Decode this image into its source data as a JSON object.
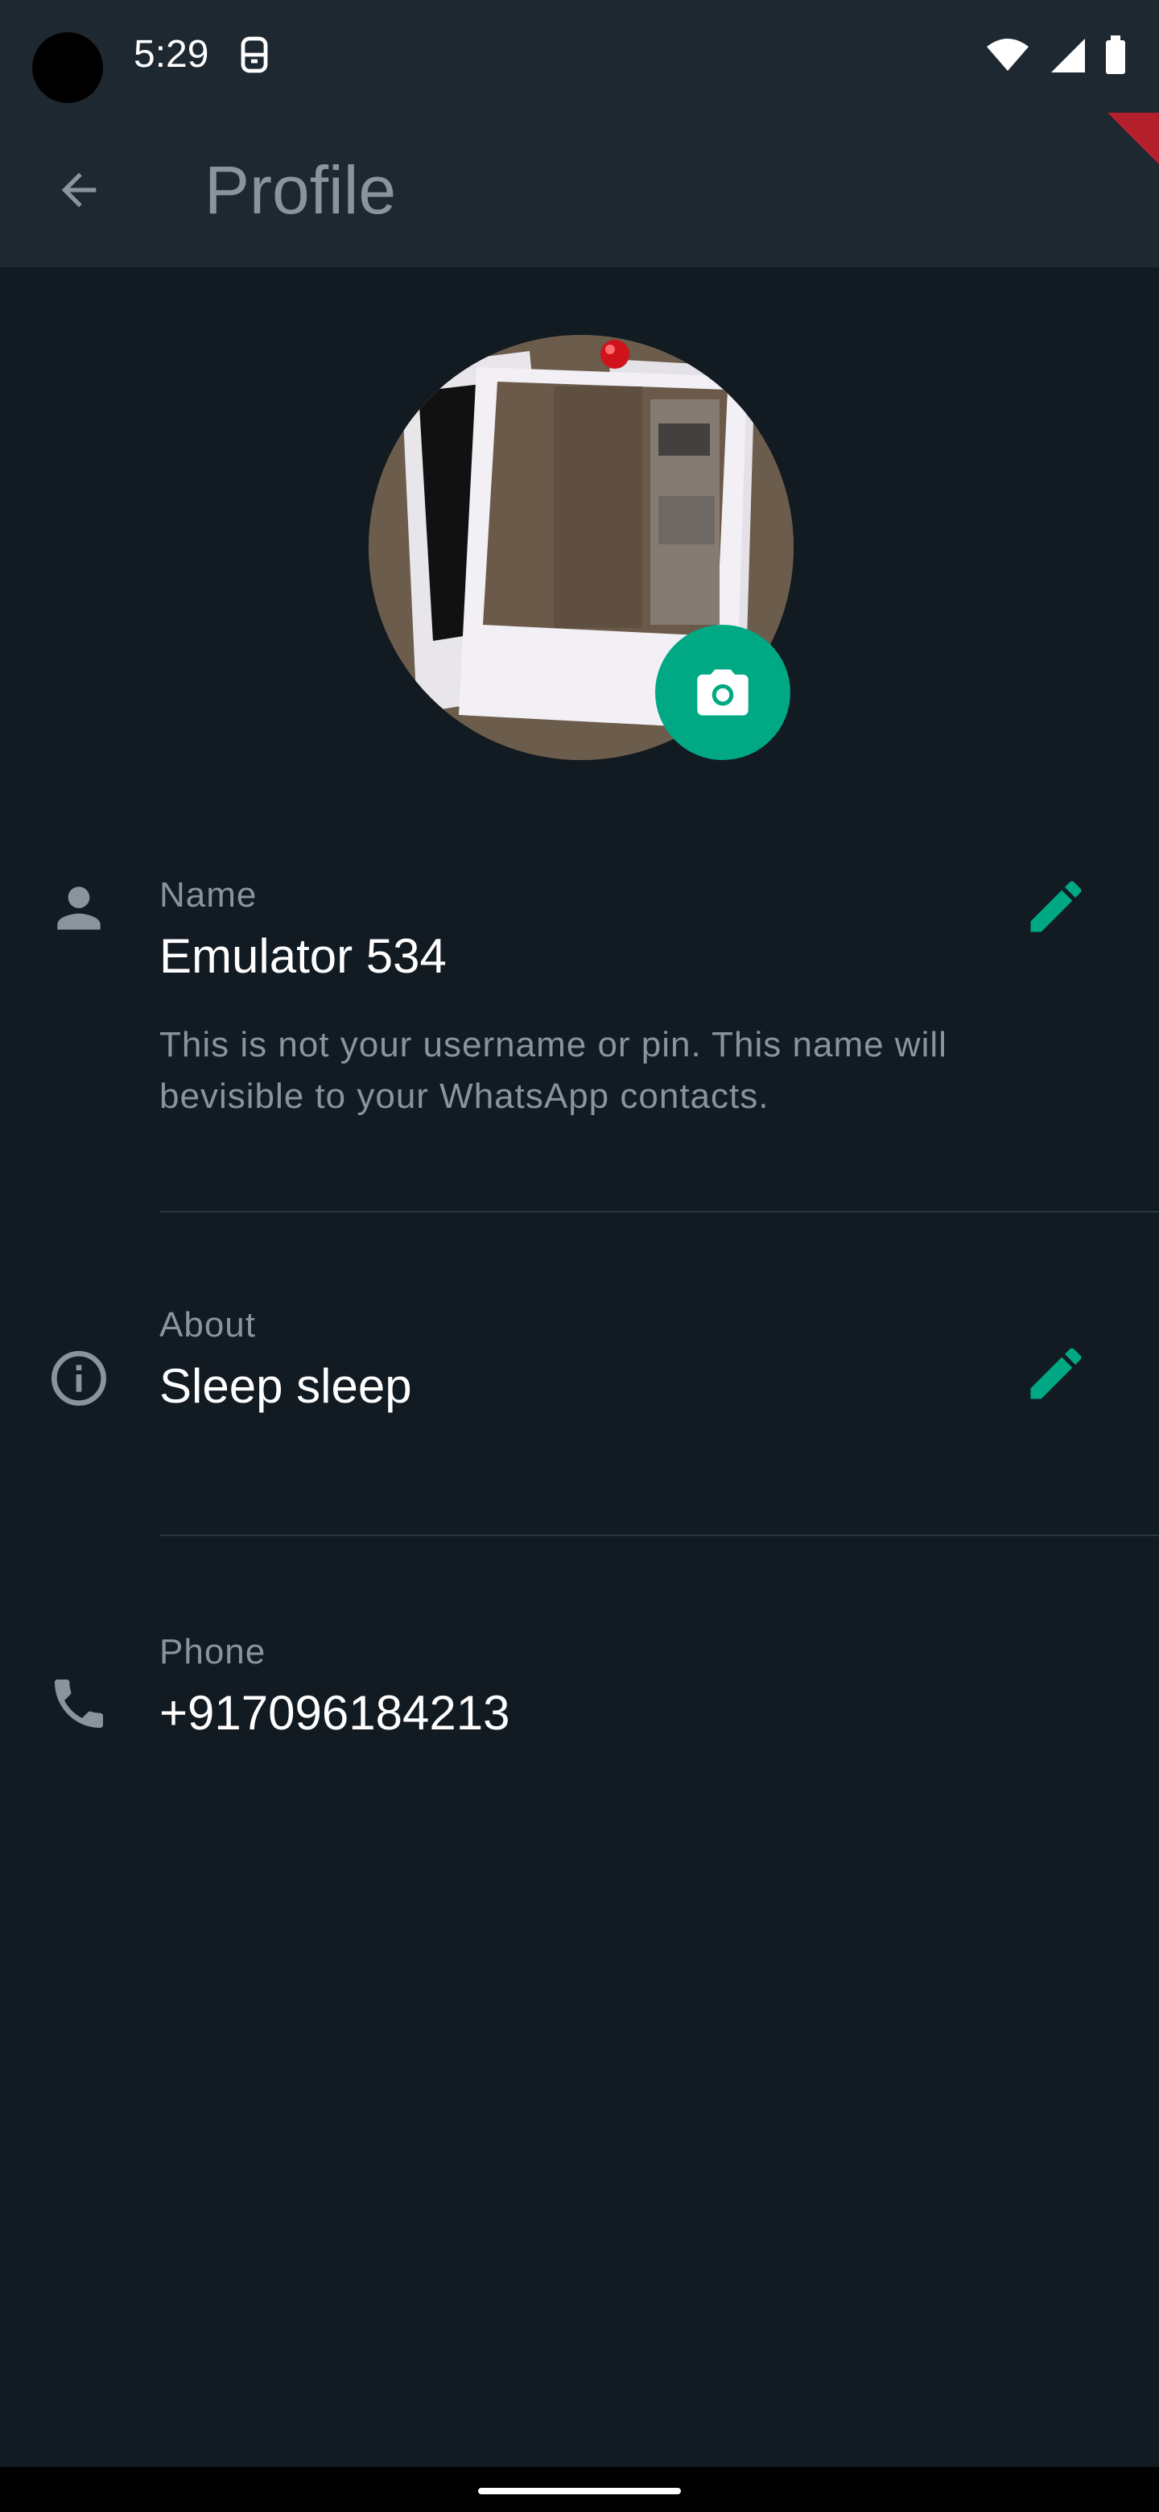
{
  "status_bar": {
    "time": "5:29"
  },
  "app_bar": {
    "title": "Profile"
  },
  "profile": {
    "name_label": "Name",
    "name_value": "Emulator 534",
    "name_hint": "This is not your username or pin. This name will bevisible to your WhatsApp contacts.",
    "about_label": "About",
    "about_value": "Sleep sleep",
    "phone_label": "Phone",
    "phone_value": "+917096184213"
  },
  "colors": {
    "accent": "#00a884",
    "background": "#121a22",
    "app_bar": "#1e2831",
    "secondary_text": "#8a949c",
    "primary_text": "#ffffff"
  }
}
